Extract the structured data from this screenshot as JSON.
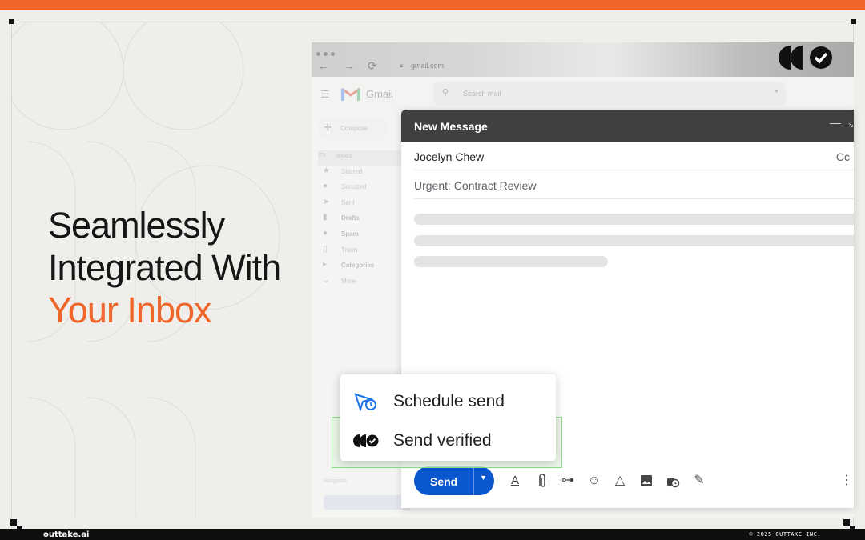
{
  "colors": {
    "accent": "#f0662a",
    "send_blue": "#0b57d0",
    "compose_header": "#404040",
    "verified_border": "#8de08a"
  },
  "headline": {
    "line1": "Seamlessly",
    "line2": "Integrated With",
    "line3_accent": "Your Inbox"
  },
  "footer": {
    "brand": "outtake.ai",
    "copyright": "© 2025 OUTTAKE INC."
  },
  "browser": {
    "url": "gmail.com",
    "app_name": "Gmail",
    "search_placeholder": "Search mail"
  },
  "sidebar": {
    "compose_label": "Compose",
    "items": [
      {
        "label": "Inbox",
        "icon": "inbox-icon"
      },
      {
        "label": "Starred",
        "icon": "star-icon"
      },
      {
        "label": "Snoozed",
        "icon": "clock-icon"
      },
      {
        "label": "Sent",
        "icon": "send-icon"
      },
      {
        "label": "Drafts",
        "icon": "draft-icon"
      },
      {
        "label": "Spam",
        "icon": "spam-icon"
      },
      {
        "label": "Trash",
        "icon": "trash-icon"
      },
      {
        "label": "Categories",
        "icon": "label-icon"
      },
      {
        "label": "More",
        "icon": "chevron-down-icon"
      }
    ],
    "footer_text": "Hangouts"
  },
  "compose": {
    "title": "New Message",
    "to": "Jocelyn Chew",
    "cc_label": "Cc",
    "subject": "Urgent: Contract Review",
    "send_label": "Send"
  },
  "send_menu": {
    "schedule_label": "Schedule send",
    "verified_label": "Send verified"
  }
}
